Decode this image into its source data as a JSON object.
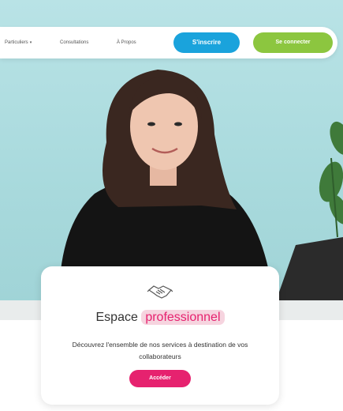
{
  "nav": {
    "items": [
      {
        "label": "Particuliers",
        "has_dropdown": true
      },
      {
        "label": "Consultations",
        "has_dropdown": false
      },
      {
        "label": "À Propos",
        "has_dropdown": false
      }
    ],
    "signup_label": "S'inscrire",
    "login_label": "Se connecter"
  },
  "card": {
    "icon": "handshake-icon",
    "title_prefix": "Espace",
    "title_highlight": "professionnel",
    "description": "Découvrez l'ensemble de nos services à destination de vos collaborateurs",
    "button_label": "Accéder"
  },
  "colors": {
    "signup": "#1aa3dc",
    "login": "#8cc63f",
    "accent": "#e6226f",
    "highlight_bg": "#f6d4df",
    "hero_bg": "#a9dadd"
  }
}
